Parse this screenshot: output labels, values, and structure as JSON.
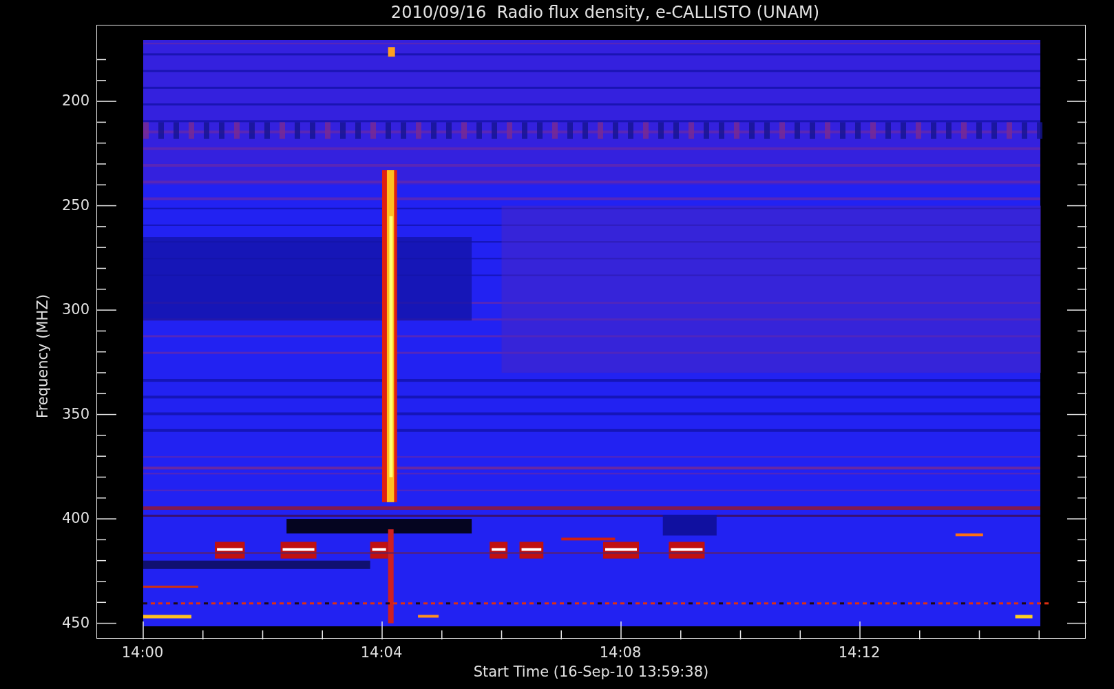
{
  "title": "2010/09/16  Radio flux density, e-CALLISTO (UNAM)",
  "y_axis": {
    "label": "Frequency (MHZ)",
    "ticks": [
      "200",
      "250",
      "300",
      "350",
      "400",
      "450"
    ]
  },
  "x_axis": {
    "label": "Start Time (16-Sep-10 13:59:38)",
    "ticks": [
      "14:00",
      "14:04",
      "14:08",
      "14:12"
    ]
  }
}
